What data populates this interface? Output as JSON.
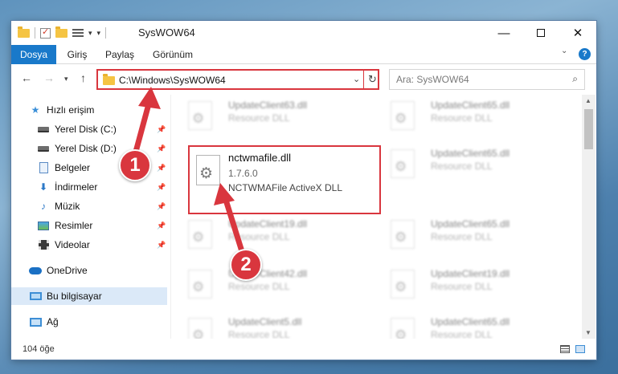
{
  "window": {
    "title": "SysWOW64",
    "controls": {
      "minimize": "—",
      "close": "✕"
    }
  },
  "ribbon": {
    "tabs": [
      "Dosya",
      "Giriş",
      "Paylaş",
      "Görünüm"
    ],
    "expand": "⌄",
    "help": "?"
  },
  "nav": {
    "back": "←",
    "forward": "→",
    "history": "▾",
    "up": "↑",
    "address": "C:\\Windows\\SysWOW64",
    "address_dropdown": "⌄",
    "refresh": "↻",
    "search_placeholder": "Ara: SysWOW64",
    "search_icon": "⌕"
  },
  "sidebar": {
    "items": [
      {
        "label": "Hızlı erişim",
        "icon": "star-icon"
      },
      {
        "label": "Yerel Disk (C:)",
        "icon": "drive-icon",
        "pinned": true
      },
      {
        "label": "Yerel Disk (D:)",
        "icon": "drive-icon",
        "pinned": true
      },
      {
        "label": "Belgeler",
        "icon": "document-icon",
        "pinned": true
      },
      {
        "label": "İndirmeler",
        "icon": "download-icon",
        "pinned": true
      },
      {
        "label": "Müzik",
        "icon": "music-icon",
        "pinned": true
      },
      {
        "label": "Resimler",
        "icon": "pictures-icon",
        "pinned": true
      },
      {
        "label": "Videolar",
        "icon": "video-icon",
        "pinned": true
      },
      {
        "label": "OneDrive",
        "icon": "onedrive-icon"
      },
      {
        "label": "Bu bilgisayar",
        "icon": "computer-icon",
        "selected": true
      },
      {
        "label": "Ağ",
        "icon": "network-icon"
      }
    ],
    "pin_glyph": "📌"
  },
  "files": {
    "left": [
      {
        "name": "UpdateClient63.dll",
        "desc": "Resource DLL"
      },
      {
        "name": "UpdateClient19.dll",
        "desc": "Resource DLL"
      },
      {
        "name": "UpdateClient42.dll",
        "desc": "Resource DLL"
      },
      {
        "name": "UpdateClient5.dll",
        "desc": "Resource DLL"
      }
    ],
    "right": [
      {
        "name": "UpdateClient65.dll",
        "desc": "Resource DLL"
      },
      {
        "name": "UpdateClient65.dll",
        "desc": "Resource DLL"
      },
      {
        "name": "UpdateClient65.dll",
        "desc": "Resource DLL"
      },
      {
        "name": "UpdateClient19.dll",
        "desc": "Resource DLL"
      },
      {
        "name": "UpdateClient65.dll",
        "desc": "Resource DLL"
      }
    ],
    "highlighted": {
      "name": "nctwmafile.dll",
      "version": "1.7.6.0",
      "desc": "NCTWMAFile ActiveX DLL"
    }
  },
  "status": {
    "count": "104 öğe"
  },
  "annotations": {
    "step1": "1",
    "step2": "2",
    "color": "#d9363e"
  },
  "colors": {
    "accent": "#1979ca",
    "highlight": "#d9363e",
    "selection": "#dbe9f8"
  }
}
